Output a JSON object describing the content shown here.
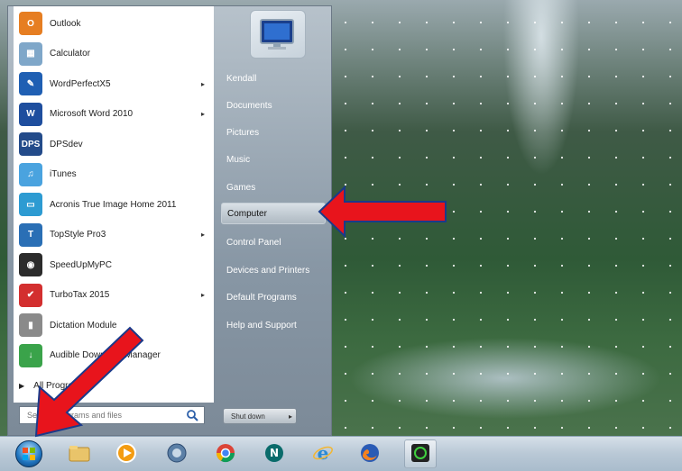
{
  "start_menu": {
    "pinned": [
      {
        "label": "Outlook",
        "icon": "outlook-icon",
        "color": "#e67e22",
        "glyph": "O"
      },
      {
        "label": "Calculator",
        "icon": "calculator-icon",
        "color": "#7fa7c9",
        "glyph": "▦"
      },
      {
        "label": "WordPerfectX5",
        "icon": "wordperfect-icon",
        "color": "#1f5fb3",
        "glyph": "✎",
        "arrow": "▸"
      },
      {
        "label": "Microsoft Word 2010",
        "icon": "word-icon",
        "color": "#1e4e9e",
        "glyph": "W",
        "arrow": "▸"
      },
      {
        "label": "DPSdev",
        "icon": "dpsdev-icon",
        "color": "#234b8a",
        "glyph": "DPS"
      },
      {
        "label": "iTunes",
        "icon": "itunes-icon",
        "color": "#4aa3df",
        "glyph": "♫"
      },
      {
        "label": "Acronis True Image Home 2011",
        "icon": "acronis-icon",
        "color": "#2d9bd2",
        "glyph": "▭"
      },
      {
        "label": "TopStyle Pro3",
        "icon": "topstyle-icon",
        "color": "#2a6fb5",
        "glyph": "T",
        "arrow": "▸"
      },
      {
        "label": "SpeedUpMyPC",
        "icon": "speedupmypc-icon",
        "color": "#2b2b2b",
        "glyph": "◉"
      },
      {
        "label": "TurboTax 2015",
        "icon": "turbotax-icon",
        "color": "#d32f2f",
        "glyph": "✔",
        "arrow": "▸"
      },
      {
        "label": "Dictation Module",
        "icon": "dictation-icon",
        "color": "#8a8a8a",
        "glyph": "▮"
      },
      {
        "label": "Audible Download Manager",
        "icon": "audible-icon",
        "color": "#3aa34a",
        "glyph": "↓"
      }
    ],
    "all_programs": "All Programs",
    "search_placeholder": "Search programs and files",
    "right_pane": {
      "user": "Kendall",
      "items": [
        "Documents",
        "Pictures",
        "Music",
        "Games",
        "Computer",
        "Control Panel",
        "Devices and Printers",
        "Default Programs",
        "Help and Support"
      ],
      "selected": "Computer"
    },
    "shutdown_label": "Shut down"
  },
  "taskbar": {
    "start_icon": "windows-orb-icon",
    "buttons": [
      "explorer-icon",
      "media-player-icon",
      "desktop-gadget-icon",
      "chrome-icon",
      "netscape-icon",
      "internet-explorer-icon",
      "firefox-icon",
      "speedupmypc-icon"
    ]
  },
  "colors": {
    "arrow": "#e8141c",
    "arrow_outline": "#1a3a8a"
  }
}
